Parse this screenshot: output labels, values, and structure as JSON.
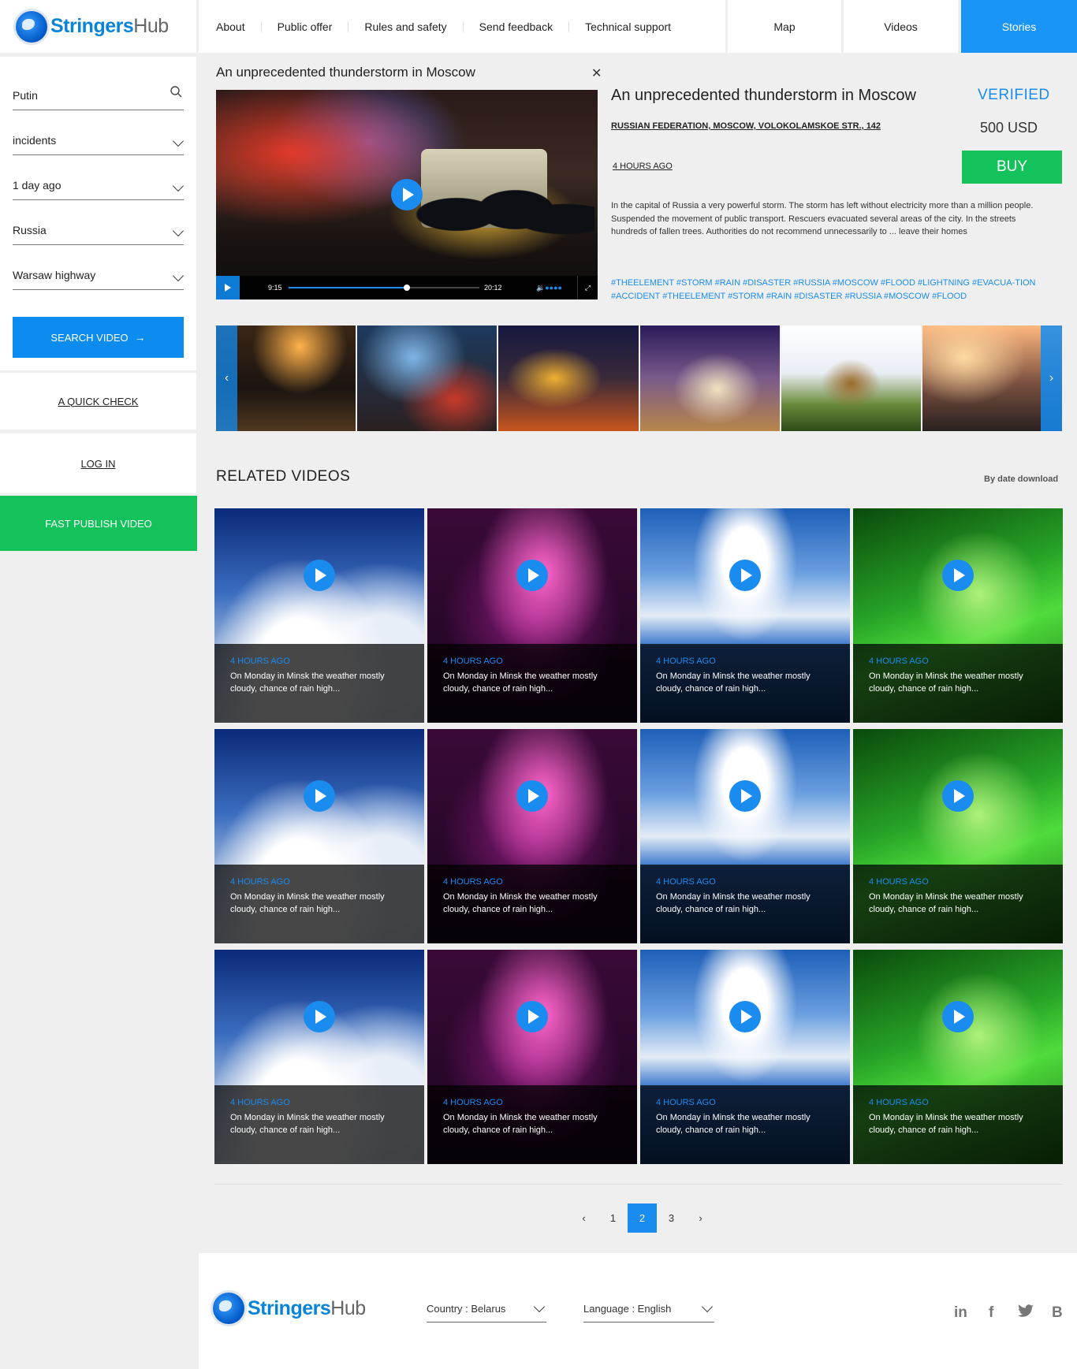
{
  "brand": {
    "name_a": "Stringers",
    "name_b": "Hub"
  },
  "nav": {
    "items": [
      "About",
      "Public offer",
      "Rules and safety",
      "Send feedback",
      "Technical support"
    ]
  },
  "tabs": [
    "Map",
    "Videos",
    "Stories"
  ],
  "filters": {
    "search_value": "Putin",
    "category": "incidents",
    "period": "1 day ago",
    "country": "Russia",
    "location": "Warsaw highway",
    "search_button": "SEARCH VIDEO"
  },
  "sidebar": {
    "quick_check": "A QUICK CHECK",
    "login": "LOG IN",
    "fast_publish": "FAST PUBLISH VIDEO"
  },
  "player": {
    "title": "An unprecedented thunderstorm in Moscow",
    "time_current": "9:15",
    "time_total": "20:12",
    "progress": 0.62
  },
  "story": {
    "title": "An unprecedented thunderstorm in Moscow",
    "status": "VERIFIED",
    "price": "500 USD",
    "address": "RUSSIAN FEDERATION, MOSCOW, VOLOKOLAMSKOE STR., 142",
    "ago": "4 HOURS AGO",
    "buy": "BUY",
    "description": "In the capital of Russia a very powerful storm. The storm has left without electricity more than a million people. Suspended the movement of public transport. Rescuers evacuated several areas of the city. In the streets hundreds of fallen trees. Authorities do not recommend unnecessarily to ... leave their homes",
    "tags": "#THEELEMENT #STORM #RAIN #DISASTER #RUSSIA #MOSCOW #FLOOD #LIGHTNING #EVACUA-TION #ACCIDENT #THEELEMENT #STORM #RAIN #DISASTER #RUSSIA #MOSCOW #FLOOD"
  },
  "related": {
    "heading": "RELATED VIDEOS",
    "sort": "By date download",
    "card_time": "4 HOURS AGO",
    "card_text": "On Monday in Minsk the weather mostly cloudy, chance of rain high..."
  },
  "pagination": {
    "pages": [
      "1",
      "2",
      "3"
    ],
    "current": "2"
  },
  "footer": {
    "country": "Country : Belarus",
    "language": "Language : English",
    "social": [
      "in",
      "f",
      "t",
      "B"
    ]
  },
  "colors": {
    "accent": "#1a8cf0",
    "buy": "#13c25a"
  }
}
